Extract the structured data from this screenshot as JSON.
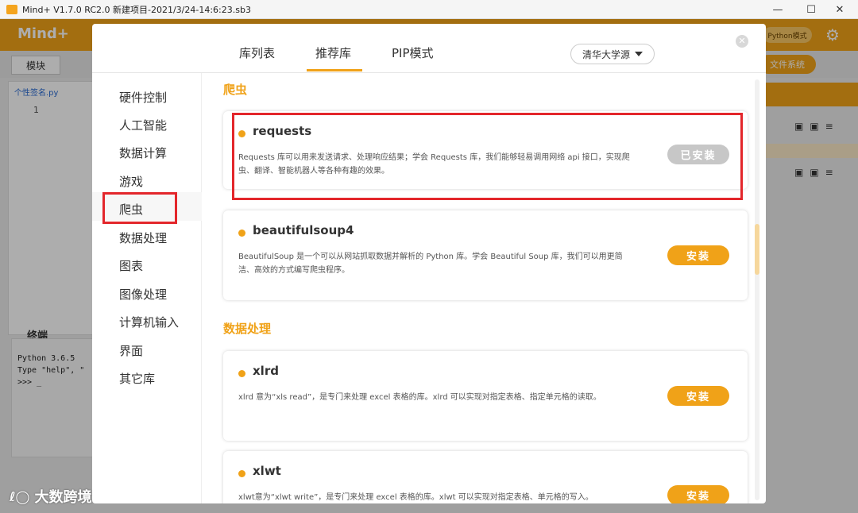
{
  "window": {
    "title": "Mind+ V1.7.0 RC2.0   新建项目-2021/3/24-14:6:23.sb3",
    "minimize": "—",
    "maximize": "☐",
    "close": "✕"
  },
  "background": {
    "logo": "Mind+",
    "python_mode": "Python模式",
    "modules_tab": "模块",
    "file_system": "文件系统",
    "file_tab": "个性签名.py",
    "line_number": "1",
    "terminal_title": "终端",
    "terminal_text": "Python 3.6.5\nType \"help\", \"\n>>> _"
  },
  "dialog": {
    "close_icon": "✕",
    "tabs": [
      {
        "label": "库列表"
      },
      {
        "label": "推荐库"
      },
      {
        "label": "PIP模式"
      }
    ],
    "source": "清华大学源",
    "sidebar": [
      {
        "label": "硬件控制"
      },
      {
        "label": "人工智能"
      },
      {
        "label": "数据计算"
      },
      {
        "label": "游戏"
      },
      {
        "label": "爬虫"
      },
      {
        "label": "数据处理"
      },
      {
        "label": "图表"
      },
      {
        "label": "图像处理"
      },
      {
        "label": "计算机输入"
      },
      {
        "label": "界面"
      },
      {
        "label": "其它库"
      }
    ],
    "sections": [
      {
        "title": "爬虫",
        "libraries": [
          {
            "name": "requests",
            "desc": "Requests 库可以用来发送请求、处理响应结果；学会 Requests 库，我们能够轻易调用网络 api 接口，实现爬虫、翻译、智能机器人等各种有趣的效果。",
            "button": "已安装",
            "installed": true
          },
          {
            "name": "beautifulsoup4",
            "desc": "BeautifulSoup 是一个可以从网站抓取数据并解析的 Python 库。学会 Beautiful Soup 库，我们可以用更简洁、高效的方式编写爬虫程序。",
            "button": "安装",
            "installed": false
          }
        ]
      },
      {
        "title": "数据处理",
        "libraries": [
          {
            "name": "xlrd",
            "desc": "xlrd 意为“xls read”，是专门来处理 excel 表格的库。xlrd 可以实现对指定表格、指定单元格的读取。",
            "button": "安装",
            "installed": false
          },
          {
            "name": "xlwt",
            "desc": "xlwt意为“xlwt write”，是专门来处理 excel 表格的库。xlwt 可以实现对指定表格、单元格的写入。",
            "button": "安装",
            "installed": false
          }
        ]
      }
    ]
  },
  "watermark": {
    "logo": "ℓ◯",
    "text": "大数跨境"
  },
  "colors": {
    "accent": "#f0a218",
    "highlight_box": "#e3262b",
    "installed_button": "#c7c7c7"
  }
}
